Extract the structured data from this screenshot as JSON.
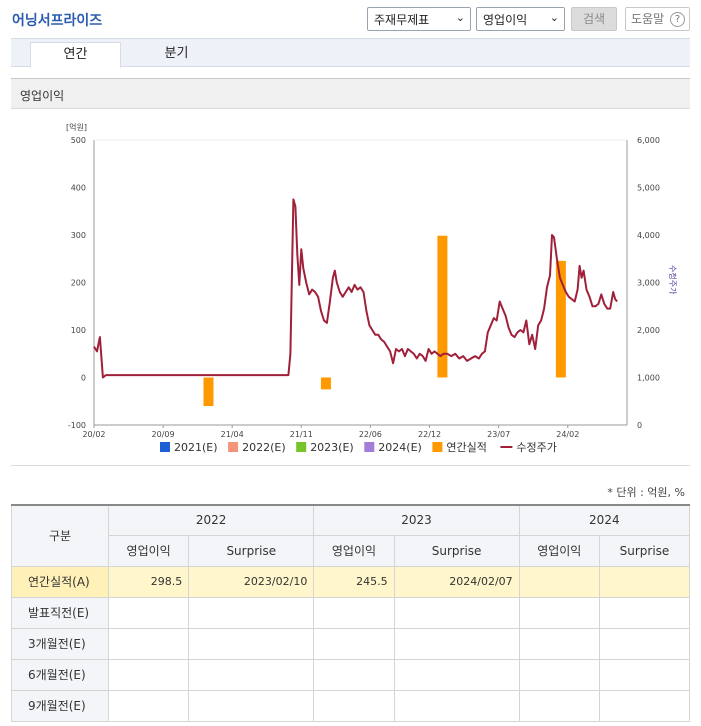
{
  "header": {
    "title": "어닝서프라이즈",
    "select1": "주재무제표",
    "select2": "영업이익",
    "search_label": "검색",
    "help_label": "도움말",
    "help_glyph": "?"
  },
  "tabs": [
    {
      "label": "연간",
      "active": true
    },
    {
      "label": "분기",
      "active": false
    }
  ],
  "section_title": "영업이익",
  "chart_data": {
    "type": "bar+line",
    "y_left_unit": "[억원]",
    "y_left_ticks": [
      "500",
      "400",
      "300",
      "200",
      "100",
      "0",
      "-100"
    ],
    "y_left_range": [
      -100,
      500
    ],
    "y_right_label": "수정주가",
    "y_right_ticks": [
      "6,000",
      "5,000",
      "4,000",
      "3,000",
      "2,000",
      "1,000",
      "0"
    ],
    "y_right_range": [
      0,
      6000
    ],
    "x_ticks": [
      "20/02",
      "20/09",
      "21/04",
      "21/11",
      "22/06",
      "22/12",
      "23/07",
      "24/02"
    ],
    "x_tick_index": [
      0,
      7,
      14,
      21,
      28,
      34,
      41,
      48
    ],
    "x_span": [
      0,
      54
    ],
    "bars": [
      {
        "x": 11.6,
        "value": -60,
        "color": "#ff9900"
      },
      {
        "x": 23.5,
        "value": -25,
        "color": "#ff9900"
      },
      {
        "x": 35.3,
        "value": 298.5,
        "color": "#ff9900"
      },
      {
        "x": 47.3,
        "value": 245.5,
        "color": "#ff9900"
      }
    ],
    "price_series": [
      [
        0,
        1650
      ],
      [
        0.3,
        1550
      ],
      [
        0.6,
        1850
      ],
      [
        0.9,
        1000
      ],
      [
        1.2,
        1050
      ],
      [
        2,
        1050
      ],
      [
        5,
        1050
      ],
      [
        10,
        1050
      ],
      [
        15,
        1050
      ],
      [
        19.7,
        1050
      ],
      [
        19.9,
        1500
      ],
      [
        20.2,
        4750
      ],
      [
        20.4,
        4600
      ],
      [
        20.6,
        3600
      ],
      [
        20.8,
        2950
      ],
      [
        21.0,
        3700
      ],
      [
        21.2,
        3300
      ],
      [
        21.5,
        3000
      ],
      [
        21.8,
        2750
      ],
      [
        22.1,
        2850
      ],
      [
        22.4,
        2800
      ],
      [
        22.7,
        2700
      ],
      [
        23.0,
        2400
      ],
      [
        23.3,
        2200
      ],
      [
        23.6,
        2150
      ],
      [
        23.9,
        2600
      ],
      [
        24.2,
        3100
      ],
      [
        24.4,
        3250
      ],
      [
        24.6,
        3000
      ],
      [
        24.9,
        2800
      ],
      [
        25.2,
        2700
      ],
      [
        25.5,
        2800
      ],
      [
        25.8,
        2900
      ],
      [
        26.1,
        2800
      ],
      [
        26.4,
        2950
      ],
      [
        26.7,
        2850
      ],
      [
        27.0,
        2900
      ],
      [
        27.3,
        2800
      ],
      [
        27.6,
        2400
      ],
      [
        27.9,
        2100
      ],
      [
        28.2,
        2000
      ],
      [
        28.5,
        1900
      ],
      [
        28.8,
        1900
      ],
      [
        29.1,
        1800
      ],
      [
        29.4,
        1750
      ],
      [
        29.7,
        1650
      ],
      [
        30.0,
        1550
      ],
      [
        30.3,
        1300
      ],
      [
        30.6,
        1600
      ],
      [
        30.9,
        1550
      ],
      [
        31.2,
        1600
      ],
      [
        31.5,
        1450
      ],
      [
        31.8,
        1600
      ],
      [
        32.1,
        1550
      ],
      [
        32.4,
        1500
      ],
      [
        32.7,
        1400
      ],
      [
        33.0,
        1500
      ],
      [
        33.3,
        1450
      ],
      [
        33.6,
        1350
      ],
      [
        33.9,
        1600
      ],
      [
        34.2,
        1500
      ],
      [
        34.5,
        1550
      ],
      [
        34.8,
        1500
      ],
      [
        35.1,
        1450
      ],
      [
        35.4,
        1500
      ],
      [
        35.8,
        1500
      ],
      [
        36.2,
        1450
      ],
      [
        36.6,
        1500
      ],
      [
        37.0,
        1400
      ],
      [
        37.4,
        1450
      ],
      [
        37.8,
        1350
      ],
      [
        38.2,
        1400
      ],
      [
        38.6,
        1450
      ],
      [
        39.0,
        1400
      ],
      [
        39.3,
        1500
      ],
      [
        39.6,
        1550
      ],
      [
        39.9,
        1950
      ],
      [
        40.2,
        2100
      ],
      [
        40.5,
        2250
      ],
      [
        40.8,
        2200
      ],
      [
        41.1,
        2600
      ],
      [
        41.4,
        2450
      ],
      [
        41.7,
        2300
      ],
      [
        42.0,
        2050
      ],
      [
        42.3,
        1900
      ],
      [
        42.6,
        1850
      ],
      [
        42.9,
        1950
      ],
      [
        43.2,
        2000
      ],
      [
        43.5,
        1950
      ],
      [
        43.8,
        2200
      ],
      [
        44.1,
        1700
      ],
      [
        44.4,
        1900
      ],
      [
        44.7,
        1600
      ],
      [
        45.0,
        2100
      ],
      [
        45.3,
        2200
      ],
      [
        45.6,
        2450
      ],
      [
        45.9,
        2900
      ],
      [
        46.2,
        3150
      ],
      [
        46.4,
        4000
      ],
      [
        46.6,
        3950
      ],
      [
        46.9,
        3500
      ],
      [
        47.2,
        3100
      ],
      [
        47.5,
        2950
      ],
      [
        47.8,
        2800
      ],
      [
        48.1,
        2700
      ],
      [
        48.4,
        2650
      ],
      [
        48.7,
        2600
      ],
      [
        49.0,
        2850
      ],
      [
        49.2,
        3350
      ],
      [
        49.4,
        3100
      ],
      [
        49.6,
        3250
      ],
      [
        49.9,
        2850
      ],
      [
        50.2,
        2700
      ],
      [
        50.5,
        2500
      ],
      [
        50.8,
        2500
      ],
      [
        51.1,
        2550
      ],
      [
        51.4,
        2750
      ],
      [
        51.7,
        2550
      ],
      [
        52.0,
        2450
      ],
      [
        52.3,
        2450
      ],
      [
        52.6,
        2800
      ],
      [
        52.8,
        2650
      ],
      [
        53.0,
        2600
      ]
    ],
    "price_color": "#a0203a",
    "legend": [
      {
        "label": "2021(E)",
        "color": "#1f5fd6",
        "kind": "box"
      },
      {
        "label": "2022(E)",
        "color": "#f4947a",
        "kind": "box"
      },
      {
        "label": "2023(E)",
        "color": "#77c42a",
        "kind": "box"
      },
      {
        "label": "2024(E)",
        "color": "#a27ed8",
        "kind": "box"
      },
      {
        "label": "연간실적",
        "color": "#ff9900",
        "kind": "box"
      },
      {
        "label": "수정주가",
        "color": "#a0203a",
        "kind": "line"
      }
    ]
  },
  "unit_note": "* 단위 : 억원, %",
  "table": {
    "corner": "구분",
    "years": [
      "2022",
      "2023",
      "2024"
    ],
    "subcols": [
      "영업이익",
      "Surprise"
    ],
    "rows": [
      {
        "label": "연간실적(A)",
        "cells": [
          "298.5",
          "2023/02/10",
          "245.5",
          "2024/02/07",
          "",
          ""
        ]
      },
      {
        "label": "발표직전(E)",
        "cells": [
          "",
          "",
          "",
          "",
          "",
          ""
        ]
      },
      {
        "label": "3개월전(E)",
        "cells": [
          "",
          "",
          "",
          "",
          "",
          ""
        ]
      },
      {
        "label": "6개월전(E)",
        "cells": [
          "",
          "",
          "",
          "",
          "",
          ""
        ]
      },
      {
        "label": "9개월전(E)",
        "cells": [
          "",
          "",
          "",
          "",
          "",
          ""
        ]
      }
    ]
  }
}
